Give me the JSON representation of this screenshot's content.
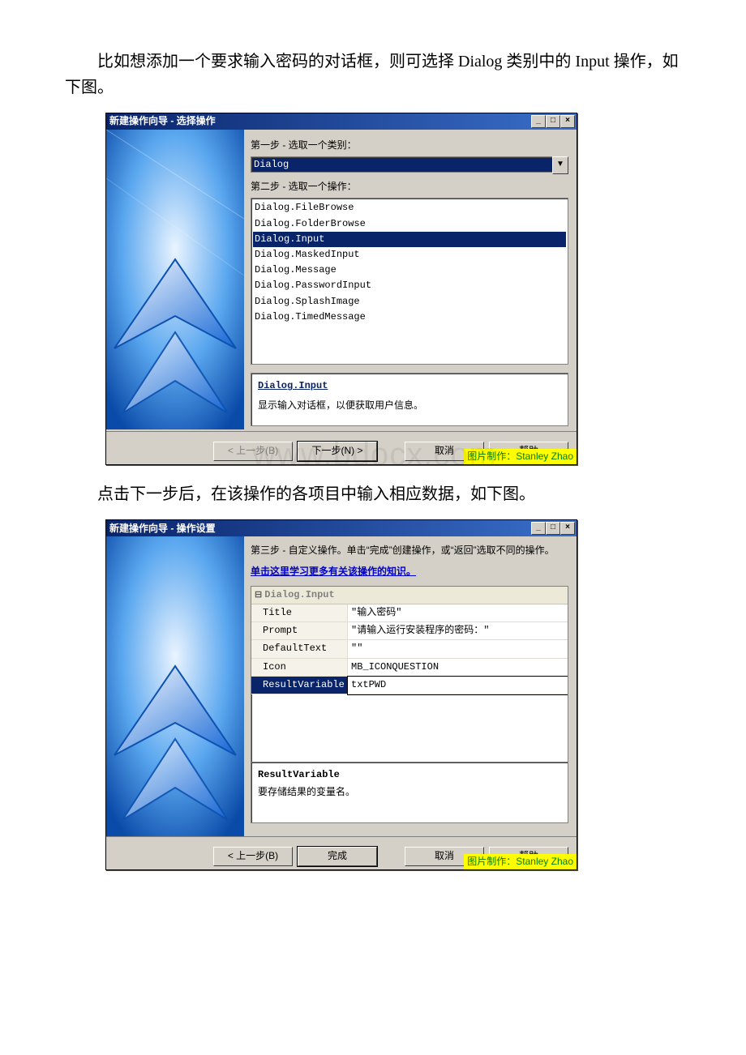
{
  "paragraphs": {
    "p1": "比如想添加一个要求输入密码的对话框，则可选择 Dialog 类别中的 Input 操作，如下图。",
    "p2": "点击下一步后，在该操作的各项目中输入相应数据，如下图。"
  },
  "dialog1": {
    "title": "新建操作向导 - 选择操作",
    "window_buttons": {
      "min": "_",
      "max": "□",
      "close": "×"
    },
    "step1_label": "第一步 - 选取一个类别：",
    "category_value": "Dialog",
    "step2_label": "第二步 - 选取一个操作：",
    "operations": [
      "Dialog.FileBrowse",
      "Dialog.FolderBrowse",
      "Dialog.Input",
      "Dialog.MaskedInput",
      "Dialog.Message",
      "Dialog.PasswordInput",
      "Dialog.SplashImage",
      "Dialog.TimedMessage"
    ],
    "selected_index": 2,
    "desc_title": "Dialog.Input",
    "desc_text": "显示输入对话框，以便获取用户信息。",
    "buttons": {
      "back": "< 上一步(B)",
      "next": "下一步(N) >",
      "cancel": "取消",
      "help": "帮助"
    },
    "credit": "图片制作：Stanley Zhao",
    "watermark": "www.bdocx.com"
  },
  "dialog2": {
    "title": "新建操作向导 - 操作设置",
    "window_buttons": {
      "min": "_",
      "max": "□",
      "close": "×"
    },
    "step3_label": "第三步 - 自定义操作。单击“完成”创建操作，或“返回”选取不同的操作。",
    "learn_link": "单击这里学习更多有关该操作的知识。",
    "group_header": "Dialog.Input",
    "properties": [
      {
        "key": "Title",
        "val": "\"输入密码\""
      },
      {
        "key": "Prompt",
        "val": "\"请输入运行安装程序的密码：\""
      },
      {
        "key": "DefaultText",
        "val": "\"\""
      },
      {
        "key": "Icon",
        "val": "MB_ICONQUESTION"
      },
      {
        "key": "ResultVariable",
        "val": "txtPWD"
      }
    ],
    "selected_prop_index": 4,
    "prop_desc_title": "ResultVariable",
    "prop_desc_text": "要存储结果的变量名。",
    "buttons": {
      "back": "< 上一步(B)",
      "finish": "完成",
      "cancel": "取消",
      "help": "帮助"
    },
    "credit": "图片制作：Stanley Zhao"
  }
}
